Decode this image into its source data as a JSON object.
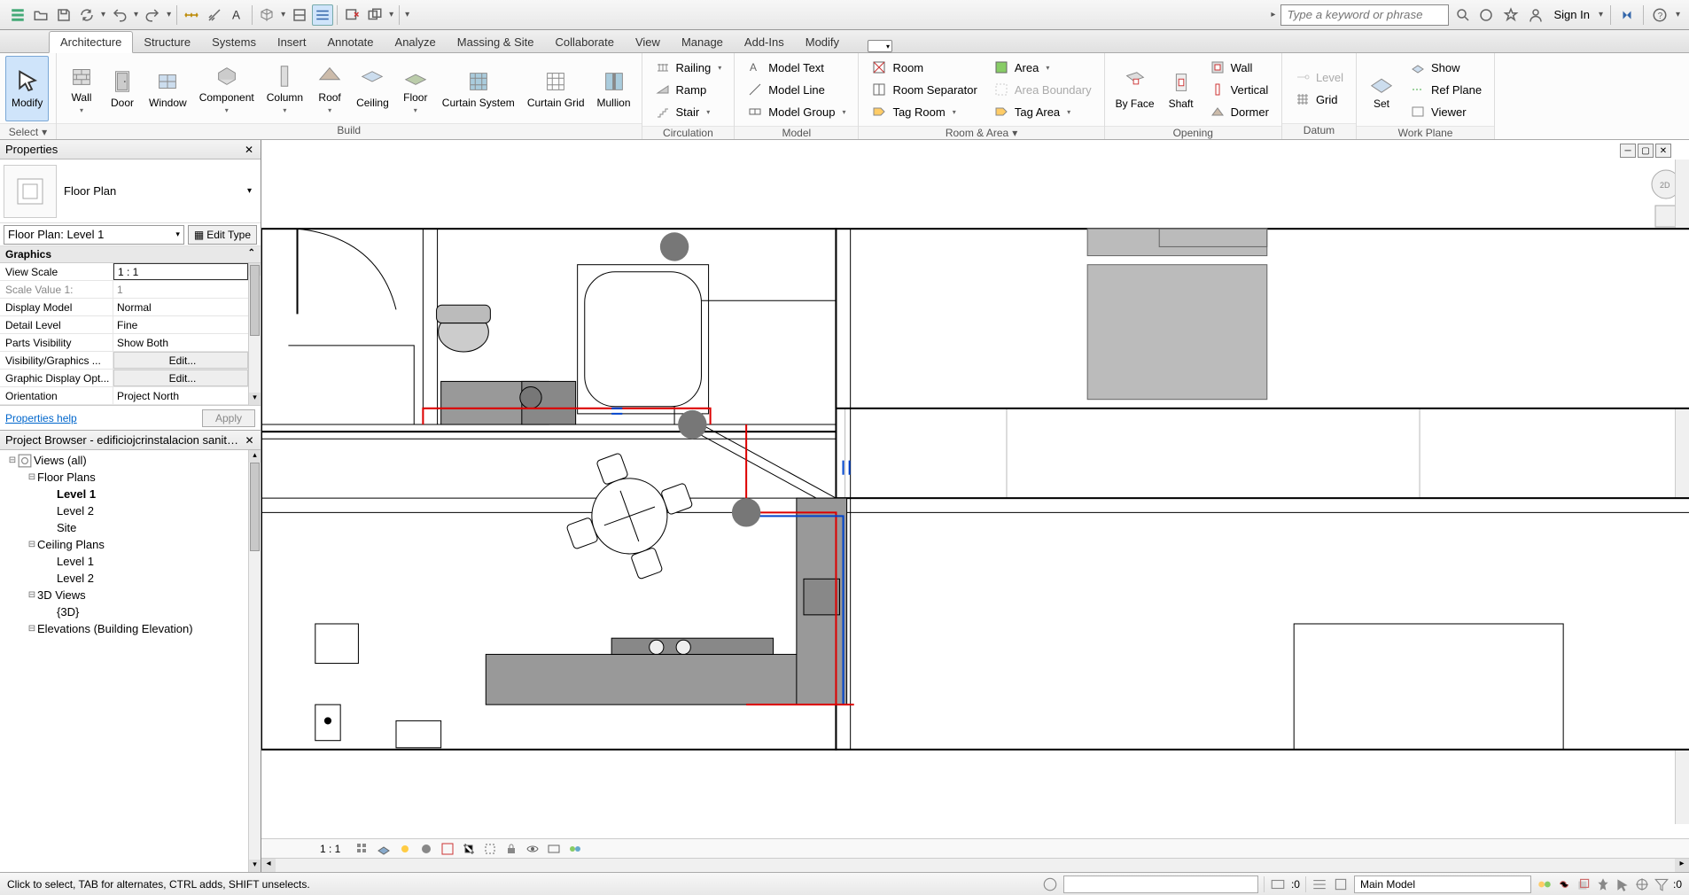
{
  "qat": {
    "search_placeholder": "Type a keyword or phrase",
    "signin": "Sign In"
  },
  "ribbon": {
    "tabs": [
      "Architecture",
      "Structure",
      "Systems",
      "Insert",
      "Annotate",
      "Analyze",
      "Massing & Site",
      "Collaborate",
      "View",
      "Manage",
      "Add-Ins",
      "Modify"
    ],
    "active_tab": 0,
    "select": "Select",
    "groups": {
      "build": {
        "label": "Build",
        "modify": "Modify",
        "wall": "Wall",
        "door": "Door",
        "window": "Window",
        "component": "Component",
        "column": "Column",
        "roof": "Roof",
        "ceiling": "Ceiling",
        "floor": "Floor",
        "curtain_system": "Curtain System",
        "curtain_grid": "Curtain Grid",
        "mullion": "Mullion"
      },
      "circulation": {
        "label": "Circulation",
        "railing": "Railing",
        "ramp": "Ramp",
        "stair": "Stair"
      },
      "model": {
        "label": "Model",
        "model_text": "Model Text",
        "model_line": "Model Line",
        "model_group": "Model Group"
      },
      "room_area": {
        "label": "Room & Area",
        "room": "Room",
        "room_sep": "Room Separator",
        "tag_room": "Tag Room",
        "area": "Area",
        "area_boundary": "Area Boundary",
        "tag_area": "Tag Area"
      },
      "opening": {
        "label": "Opening",
        "by_face": "By Face",
        "shaft": "Shaft",
        "wall": "Wall",
        "vertical": "Vertical",
        "dormer": "Dormer"
      },
      "datum": {
        "label": "Datum",
        "level": "Level",
        "grid": "Grid"
      },
      "work_plane": {
        "label": "Work Plane",
        "set": "Set",
        "show": "Show",
        "ref_plane": "Ref Plane",
        "viewer": "Viewer"
      }
    }
  },
  "properties": {
    "title": "Properties",
    "type_name": "Floor Plan",
    "instance": "Floor Plan: Level 1",
    "edit_type": "Edit Type",
    "section": "Graphics",
    "rows": [
      {
        "k": "View Scale",
        "v": "1 : 1",
        "input": true
      },
      {
        "k": "Scale Value    1:",
        "v": "1",
        "dim": true
      },
      {
        "k": "Display Model",
        "v": "Normal"
      },
      {
        "k": "Detail Level",
        "v": "Fine"
      },
      {
        "k": "Parts Visibility",
        "v": "Show Both"
      },
      {
        "k": "Visibility/Graphics ...",
        "v": "Edit...",
        "btn": true
      },
      {
        "k": "Graphic Display Opt...",
        "v": "Edit...",
        "btn": true
      },
      {
        "k": "Orientation",
        "v": "Project North"
      }
    ],
    "help": "Properties help",
    "apply": "Apply"
  },
  "browser": {
    "title": "Project Browser - edificiojcrinstalacion sanitarios...",
    "tree": [
      {
        "lvl": 0,
        "exp": "⊟",
        "ico": "views",
        "lbl": "Views (all)"
      },
      {
        "lvl": 1,
        "exp": "⊟",
        "lbl": "Floor Plans"
      },
      {
        "lvl": 2,
        "lbl": "Level 1",
        "bold": true
      },
      {
        "lvl": 2,
        "lbl": "Level 2"
      },
      {
        "lvl": 2,
        "lbl": "Site"
      },
      {
        "lvl": 1,
        "exp": "⊟",
        "lbl": "Ceiling Plans"
      },
      {
        "lvl": 2,
        "lbl": "Level 1"
      },
      {
        "lvl": 2,
        "lbl": "Level 2"
      },
      {
        "lvl": 1,
        "exp": "⊟",
        "lbl": "3D Views"
      },
      {
        "lvl": 2,
        "lbl": "{3D}"
      },
      {
        "lvl": 1,
        "exp": "⊟",
        "lbl": "Elevations (Building Elevation)"
      }
    ]
  },
  "viewbar": {
    "scale": "1 : 1"
  },
  "status": {
    "hint": "Click to select, TAB for alternates, CTRL adds, SHIFT unselects.",
    "zero": ":0",
    "workset": "Main Model"
  }
}
